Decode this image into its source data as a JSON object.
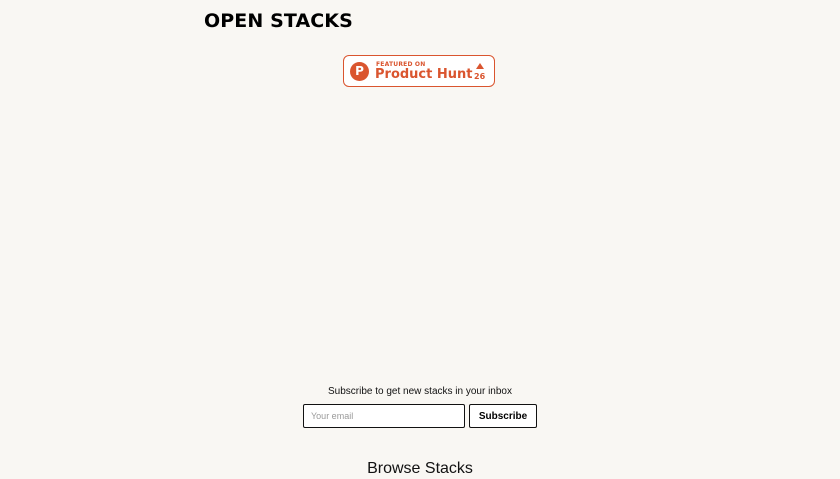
{
  "header": {
    "logo_text": "OPEN STACKS"
  },
  "product_hunt_badge": {
    "logo_letter": "P",
    "featured_label": "FEATURED ON",
    "name": "Product Hunt",
    "upvote_count": "26",
    "accent_color": "#da552f"
  },
  "newsletter": {
    "prompt": "Subscribe to get new stacks in your inbox",
    "email_placeholder": "Your email",
    "email_value": "",
    "button_label": "Subscribe"
  },
  "browse": {
    "heading": "Browse Stacks"
  },
  "colors": {
    "background": "#f9f7f3",
    "text": "#111111"
  }
}
